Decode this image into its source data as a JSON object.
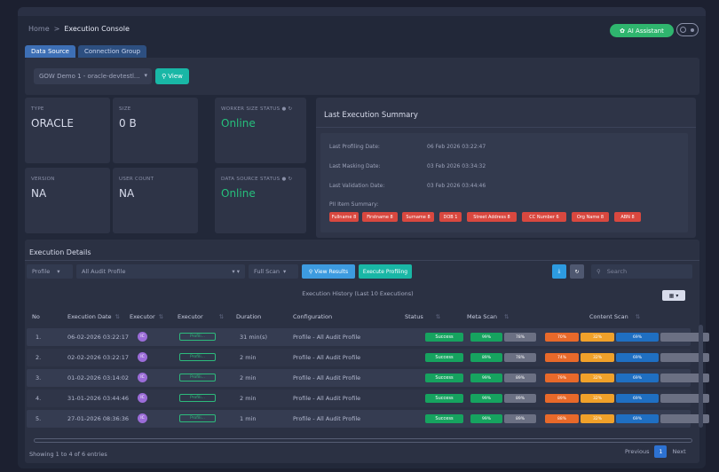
{
  "breadcrumb": {
    "home": "Home",
    "separator": ">",
    "current": "Execution Console"
  },
  "header": {
    "ai_assistant_label": "AI Assistant"
  },
  "tabs": [
    {
      "label": "Data Source"
    },
    {
      "label": "Connection Group"
    }
  ],
  "datasource": {
    "selected": "GOW Demo 1 - oracle-devtestl...",
    "view_label": "View"
  },
  "cards": {
    "type": {
      "label": "TYPE",
      "value": "ORACLE"
    },
    "size": {
      "label": "SIZE",
      "value": "0 B"
    },
    "worker_status": {
      "label": "WORKER SIZE STATUS",
      "value": "Online"
    },
    "version": {
      "label": "VERSION",
      "value": "NA"
    },
    "user_count": {
      "label": "USER COUNT",
      "value": "NA"
    },
    "ds_status": {
      "label": "DATA SOURCE STATUS",
      "value": "Online"
    }
  },
  "summary": {
    "title": "Last Execution Summary",
    "rows": [
      {
        "label": "Last Profiling Date:",
        "value": "06 Feb 2026 03:22:47"
      },
      {
        "label": "Last Masking Date:",
        "value": "03 Feb 2026 03:34:32"
      },
      {
        "label": "Last Validation Date:",
        "value": "03 Feb 2026 03:44:46"
      }
    ],
    "pii_label": "PII Item Summary:",
    "pii": [
      "Fullname 8",
      "Firstname 8",
      "Surname 8",
      "DOB 1",
      "Street Address 8",
      "CC Number 6",
      "Org Name 8",
      "ABN 8"
    ]
  },
  "execution": {
    "title": "Execution Details",
    "profile_select": "Profile",
    "audit_select": "All Audit Profile",
    "scan_select": "Full Scan",
    "view_results_label": "View Results",
    "execute_label": "Execute Profiling",
    "search_placeholder": "Search",
    "history_label": "Execution History (Last 10 Executions)",
    "columns": [
      "No",
      "Execution Date",
      "Executor",
      "Executor",
      "Duration",
      "Configuration",
      "Status",
      "Meta Scan",
      "Content Scan"
    ],
    "rows": [
      {
        "no": "1.",
        "date": "06-02-2026 03:22:17",
        "initials": "IC",
        "badge": "Profili...",
        "duration": "31 min(s)",
        "config": "Profile - All Audit Profile",
        "status": "Success",
        "meta": [
          "99%",
          "78%"
        ],
        "content": [
          "70%",
          "32%",
          "69%",
          ""
        ]
      },
      {
        "no": "2.",
        "date": "02-02-2026 03:22:17",
        "initials": "IC",
        "badge": "Profili...",
        "duration": "2 min",
        "config": "Profile - All Audit Profile",
        "status": "Success",
        "meta": [
          "89%",
          "78%"
        ],
        "content": [
          "74%",
          "32%",
          "69%",
          ""
        ]
      },
      {
        "no": "3.",
        "date": "01-02-2026 03:14:02",
        "initials": "IC",
        "badge": "Profili...",
        "duration": "2 min",
        "config": "Profile - All Audit Profile",
        "status": "Success",
        "meta": [
          "99%",
          "89%"
        ],
        "content": [
          "79%",
          "32%",
          "69%",
          ""
        ]
      },
      {
        "no": "4.",
        "date": "31-01-2026 03:44:46",
        "initials": "IC",
        "badge": "Profili...",
        "duration": "2 min",
        "config": "Profile - All Audit Profile",
        "status": "Success",
        "meta": [
          "99%",
          "89%"
        ],
        "content": [
          "89%",
          "32%",
          "69%",
          ""
        ]
      },
      {
        "no": "5.",
        "date": "27-01-2026 08:36:36",
        "initials": "IC",
        "badge": "Profili...",
        "duration": "1 min",
        "config": "Profile - All Audit Profile",
        "status": "Success",
        "meta": [
          "99%",
          "89%"
        ],
        "content": [
          "88%",
          "32%",
          "69%",
          ""
        ]
      }
    ],
    "footer": "Showing 1 to 4 of 6 entries",
    "pager": {
      "prev": "Previous",
      "page": "1",
      "next": "Next"
    }
  },
  "colors": {
    "accent_teal": "#19b7a6",
    "success": "#16a35f",
    "pii_red": "#d9483f",
    "seg_orange": "#e8692a",
    "seg_amber": "#f0a12a",
    "seg_blue": "#1f6fc2",
    "seg_grey": "#6b7083"
  }
}
